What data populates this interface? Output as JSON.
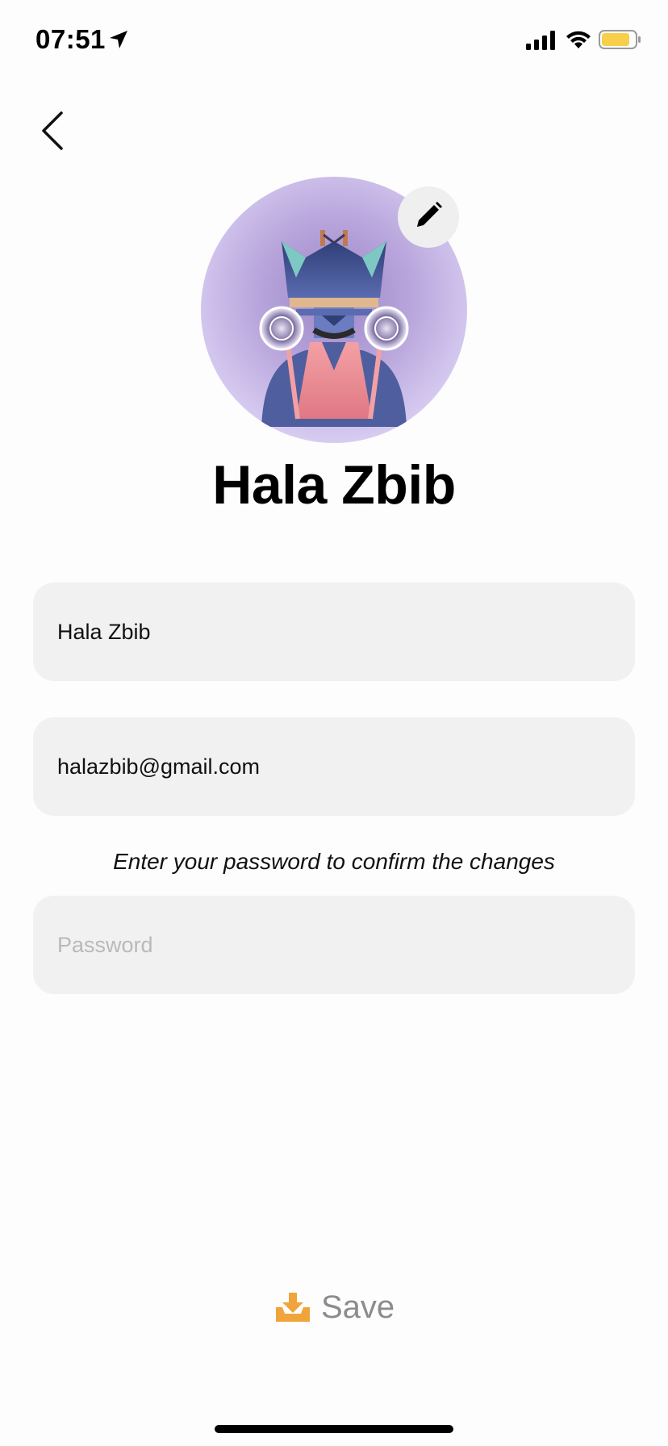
{
  "status_bar": {
    "time": "07:51",
    "icons": [
      "location-arrow-icon",
      "signal-icon",
      "wifi-icon",
      "battery-icon"
    ],
    "battery_color": "#f7cf4a"
  },
  "header": {
    "back_icon": "chevron-left-icon"
  },
  "profile": {
    "name": "Hala Zbib",
    "edit_icon": "pencil-icon"
  },
  "form": {
    "name_value": "Hala Zbib",
    "email_value": "halazbib@gmail.com",
    "confirm_hint": "Enter your password to confirm the changes",
    "password_placeholder": "Password",
    "password_value": ""
  },
  "actions": {
    "save_label": "Save",
    "save_icon": "download-tray-icon",
    "save_icon_color": "#f0a43a"
  }
}
